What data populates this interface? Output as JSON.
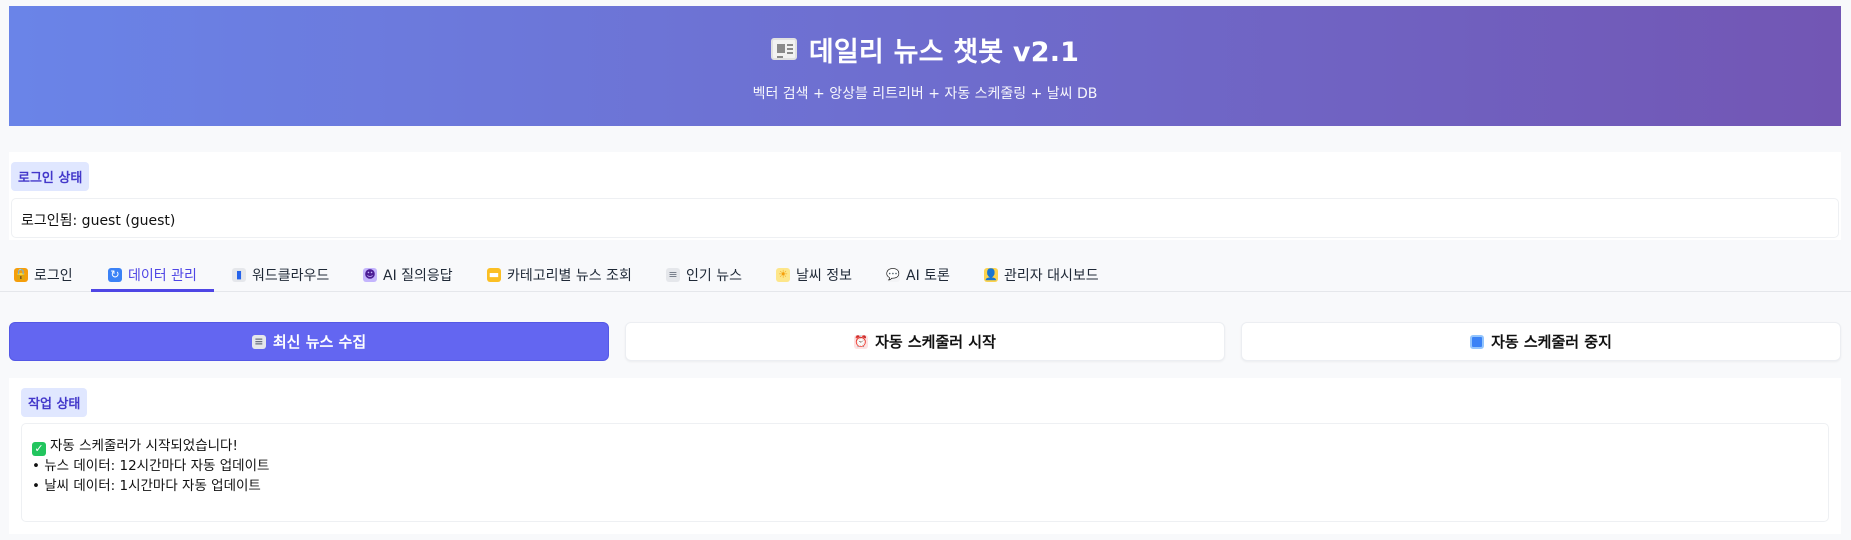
{
  "header": {
    "icon": "newspaper-icon",
    "title": "데일리 뉴스 챗봇 v2.1",
    "subtitle": "벡터 검색 + 앙상블 리트리버 + 자동 스케줄링 + 날씨 DB"
  },
  "login": {
    "chip_label": "로그인 상태",
    "status_text": "로그인됨: guest (guest)"
  },
  "tabs": [
    {
      "label": "로그인",
      "icon": "lock-icon"
    },
    {
      "label": "데이터 관리",
      "icon": "refresh-icon"
    },
    {
      "label": "워드클라우드",
      "icon": "bar-chart-icon"
    },
    {
      "label": "AI 질의응답",
      "icon": "robot-icon"
    },
    {
      "label": "카테고리별 뉴스 조회",
      "icon": "folder-icon"
    },
    {
      "label": "인기 뉴스",
      "icon": "newspaper-icon"
    },
    {
      "label": "날씨 정보",
      "icon": "sun-cloud-icon"
    },
    {
      "label": "AI 토론",
      "icon": "speech-bubble-icon"
    },
    {
      "label": "관리자 대시보드",
      "icon": "user-icon"
    }
  ],
  "active_tab": "데이터 관리",
  "actions": {
    "collect_label": "최신 뉴스 수집",
    "start_label": "자동 스케줄러 시작",
    "stop_label": "자동 스케줄러 중지"
  },
  "status": {
    "chip_label": "작업 상태",
    "line1": "자동 스케줄러가 시작되었습니다!",
    "line2": "• 뉴스 데이터: 12시간마다 자동 업데이트",
    "line3": "• 날씨 데이터: 1시간마다 자동 업데이트"
  },
  "colors": {
    "header_gradient_start": "#6a84e8",
    "header_gradient_end": "#7256b4",
    "accent": "#6366f1",
    "chip_bg": "#e0e7ff",
    "chip_text": "#4338ca"
  }
}
